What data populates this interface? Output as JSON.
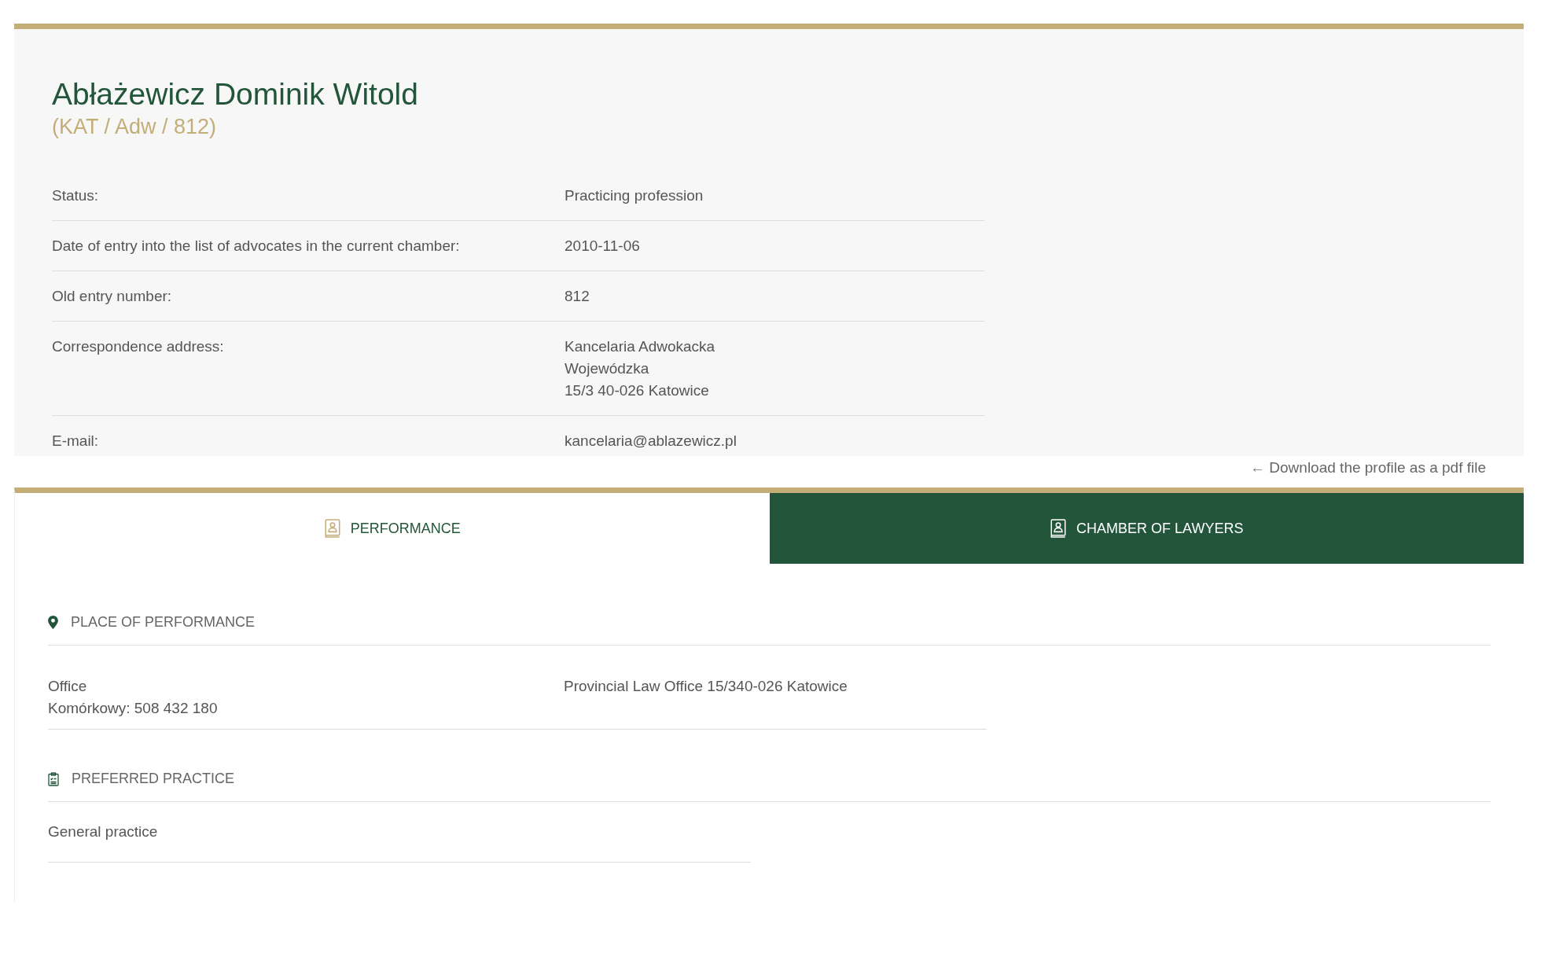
{
  "profile": {
    "name": "Abłażewicz Dominik Witold",
    "registry_id": "(KAT / Adw / 812)",
    "details": [
      {
        "label": "Status:",
        "value": [
          "Practicing profession"
        ]
      },
      {
        "label": "Date of entry into the list of advocates in the current chamber:",
        "value": [
          "2010-11-06"
        ]
      },
      {
        "label": "Old entry number:",
        "value": [
          "812"
        ]
      },
      {
        "label": "Correspondence address:",
        "value": [
          "Kancelaria Adwokacka",
          "Wojewódzka",
          "15/3 40-026 Katowice"
        ]
      },
      {
        "label": "E-mail:",
        "value": [
          "kancelaria@ablazewicz.pl"
        ]
      }
    ],
    "download_link": {
      "arrow": "←",
      "label": "Download the profile as a pdf file"
    }
  },
  "tabs": [
    {
      "label": "PERFORMANCE",
      "selected": true
    },
    {
      "label": "CHAMBER OF LAWYERS",
      "selected": false
    }
  ],
  "sections": [
    {
      "kind": "place",
      "title": "PLACE OF PERFORMANCE",
      "rows": [
        {
          "left": [
            "Office",
            "Komórkowy: 508 432 180"
          ],
          "right": "Provincial Law Office 15/340-026 Katowice"
        }
      ]
    },
    {
      "kind": "practice",
      "title": "PREFERRED PRACTICE",
      "rows": [
        {
          "left": [
            "General practice"
          ]
        }
      ]
    }
  ]
}
